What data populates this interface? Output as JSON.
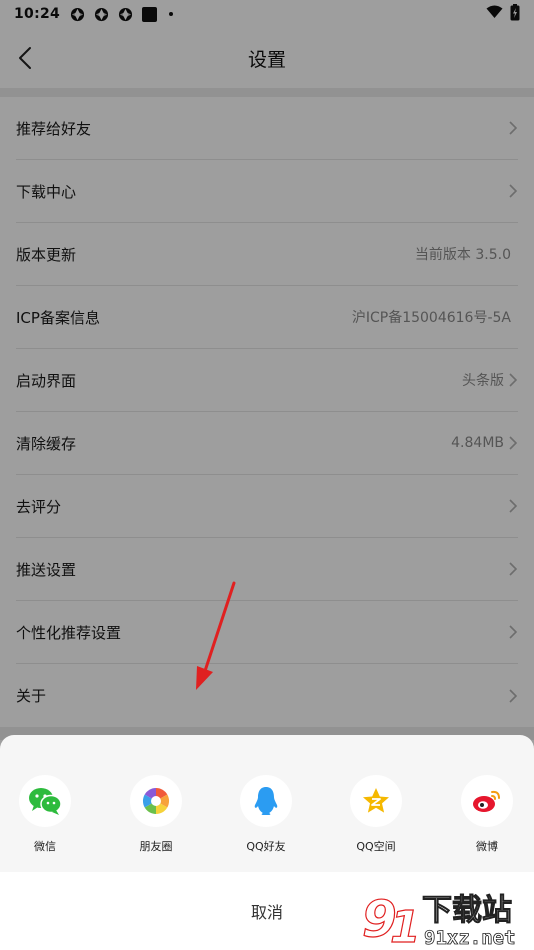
{
  "status_bar": {
    "time": "10:24"
  },
  "header": {
    "title": "设置"
  },
  "settings": [
    {
      "label": "推荐给好友",
      "value": "",
      "chevron": true
    },
    {
      "label": "下载中心",
      "value": "",
      "chevron": true
    },
    {
      "label": "版本更新",
      "value": "当前版本 3.5.0",
      "chevron": false
    },
    {
      "label": "ICP备案信息",
      "value": "沪ICP备15004616号-5A",
      "chevron": false
    },
    {
      "label": "启动界面",
      "value": "头条版",
      "chevron": true
    },
    {
      "label": "清除缓存",
      "value": "4.84MB",
      "chevron": true
    },
    {
      "label": "去评分",
      "value": "",
      "chevron": true
    },
    {
      "label": "推送设置",
      "value": "",
      "chevron": true
    },
    {
      "label": "个性化推荐设置",
      "value": "",
      "chevron": true
    },
    {
      "label": "关于",
      "value": "",
      "chevron": true
    }
  ],
  "share_sheet": {
    "items": [
      {
        "label": "微信",
        "icon": "wechat-icon",
        "color": "#2dbb3d"
      },
      {
        "label": "朋友圈",
        "icon": "moments-icon",
        "color": "#f0a030"
      },
      {
        "label": "QQ好友",
        "icon": "qq-icon",
        "color": "#2b9cf2"
      },
      {
        "label": "QQ空间",
        "icon": "qzone-icon",
        "color": "#f5b800"
      },
      {
        "label": "微博",
        "icon": "weibo-icon",
        "color": "#e6162d"
      }
    ],
    "cancel_label": "取消"
  },
  "watermark": {
    "text": "下载站",
    "domain": "91xz.net"
  },
  "colors": {
    "annotation_arrow": "#e02020",
    "overlay": "rgba(0,0,0,0.38)"
  }
}
